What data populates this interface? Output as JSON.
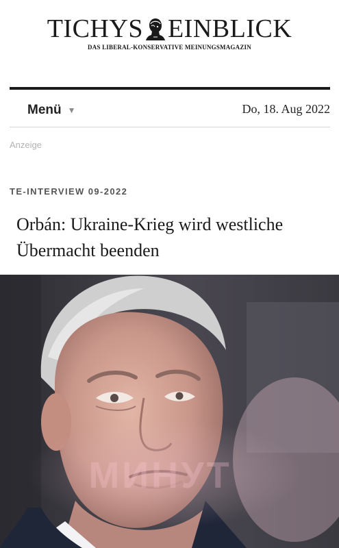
{
  "masthead": {
    "logo_left": "TICHYS",
    "logo_right": "EINBLICK",
    "tagline": "DAS LIBERAL-KONSERVATIVE MEINUNGSMAGAZIN",
    "logo_icon": "classical-bust-icon"
  },
  "nav": {
    "menu_label": "Menü",
    "menu_icon": "chevron-down-icon",
    "date": "Do, 18. Aug 2022"
  },
  "ad_label": "Anzeige",
  "article": {
    "kicker": "TE-INTERVIEW 09-2022",
    "title": "Orbán: Ukraine-Krieg wird westli­che Übermacht beenden",
    "image_watermark": "МИНУТ"
  },
  "colors": {
    "text": "#1a1a1a",
    "rule": "#1a1a1a",
    "muted": "#b3b3b3"
  }
}
